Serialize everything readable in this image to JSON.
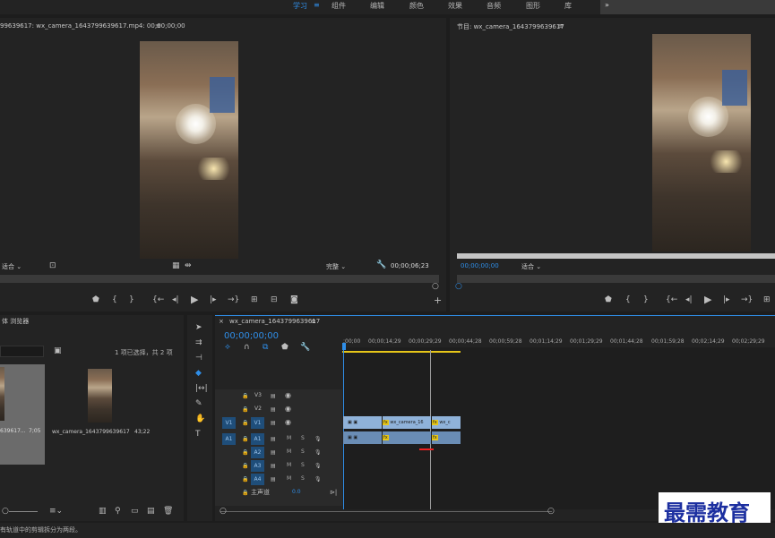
{
  "workspaces": {
    "items": [
      "学习",
      "组件",
      "编辑",
      "颜色",
      "效果",
      "音频",
      "图形",
      "库"
    ],
    "more": "»"
  },
  "source_monitor": {
    "title": "99639617: wx_camera_1643799639617.mp4: 00;00;00;00",
    "menu": "≡",
    "fit": "适合",
    "quality": "完整",
    "timecode": "00;00;06;23"
  },
  "program_monitor": {
    "title": "节目: wx_camera_1643799639617",
    "menu": "≡",
    "timecode": "00;00;00;00",
    "fit": "适合"
  },
  "project": {
    "title": "体 浏览器",
    "selection_info": "1 项已选择，共 2 项",
    "items": [
      {
        "name": "639617...",
        "duration": "7;05"
      },
      {
        "name": "wx_camera_1643799639617",
        "duration": "43;22"
      }
    ]
  },
  "timeline": {
    "tab_title": "wx_camera_1643799639617",
    "menu": "≡",
    "timecode": "00;00;00;00",
    "ruler": [
      ";00;00",
      "00;00;14;29",
      "00;00;29;29",
      "00;00;44;28",
      "00;00;59;28",
      "00;01;14;29",
      "00;01;29;29",
      "00;01;44;28",
      "00;01;59;28",
      "00;02;14;29",
      "00;02;29;29"
    ],
    "video_tracks": [
      {
        "src": "",
        "name": "V3"
      },
      {
        "src": "",
        "name": "V2"
      },
      {
        "src": "V1",
        "name": "V1"
      }
    ],
    "audio_tracks": [
      {
        "src": "A1",
        "name": "A1"
      },
      {
        "src": "",
        "name": "A2"
      },
      {
        "src": "",
        "name": "A3"
      },
      {
        "src": "",
        "name": "A4"
      }
    ],
    "mute": "M",
    "solo": "S",
    "master": "主声道",
    "master_value": "0.0",
    "clips": {
      "v1_a": "wx_camera_16",
      "v1_b": "wx_c",
      "fx": "fx"
    }
  },
  "status": {
    "text": "有轨道中的剪辑拆分为两段。"
  },
  "watermark": "最需教育",
  "colors": {
    "accent": "#2f8ee8",
    "clip_video": "#8fb2d9",
    "clip_audio": "#8fb2d9",
    "panel": "#232323"
  }
}
